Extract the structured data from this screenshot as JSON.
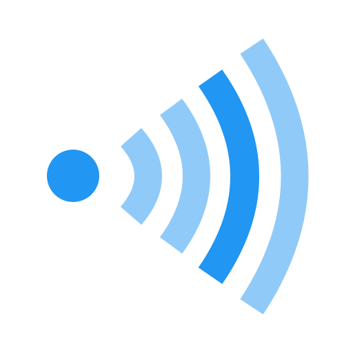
{
  "icon": {
    "name": "signal-broadcast-icon",
    "colors": {
      "background": "#ffffff",
      "primary": "#2196f3",
      "secondary": "#90caf9"
    },
    "waves": [
      {
        "name": "wave-1",
        "color": "#90caf9"
      },
      {
        "name": "wave-2",
        "color": "#90caf9"
      },
      {
        "name": "wave-3",
        "color": "#2196f3"
      },
      {
        "name": "wave-4",
        "color": "#90caf9"
      }
    ],
    "dot": {
      "name": "source-dot",
      "color": "#2196f3"
    }
  }
}
